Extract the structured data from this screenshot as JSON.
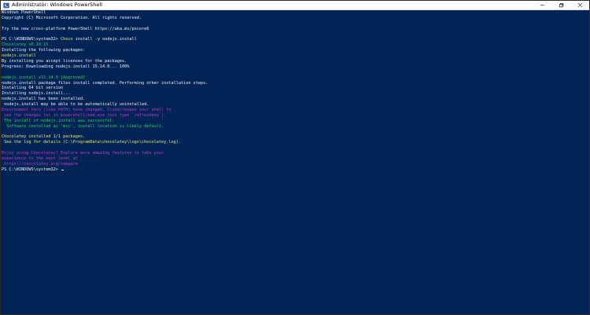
{
  "window": {
    "title": "Administrator: Windows PowerShell",
    "icon": "powershell-icon",
    "controls": [
      "minimize-icon",
      "maximize-icon",
      "close-icon"
    ]
  },
  "colors": {
    "console_bg": "#012456",
    "text": "#f0f0f0",
    "yellow": "#e9e66a",
    "green": "#2fd35a",
    "magenta": "#d033d8"
  },
  "console": {
    "lines": [
      {
        "segments": [
          {
            "text": "Windows PowerShell",
            "color": "white"
          }
        ]
      },
      {
        "segments": [
          {
            "text": "Copyright (C) Microsoft Corporation. All rights reserved.",
            "color": "white"
          }
        ]
      },
      {
        "segments": [
          {
            "text": "",
            "color": "white"
          }
        ]
      },
      {
        "segments": [
          {
            "text": "Try the new cross-platform PowerShell https://aka.ms/pscore6",
            "color": "white"
          }
        ]
      },
      {
        "segments": [
          {
            "text": "",
            "color": "white"
          }
        ]
      },
      {
        "segments": [
          {
            "text": "PS C:\\WINDOWS\\system32> ",
            "color": "white"
          },
          {
            "text": "Choco",
            "color": "yellow"
          },
          {
            "text": " install -y nodejs.install",
            "color": "white"
          }
        ]
      },
      {
        "segments": [
          {
            "text": "Chocolatey v0.10.15",
            "color": "green"
          }
        ]
      },
      {
        "segments": [
          {
            "text": "Installing the following packages:",
            "color": "white"
          }
        ]
      },
      {
        "segments": [
          {
            "text": "nodejs.install",
            "color": "yellow"
          }
        ]
      },
      {
        "segments": [
          {
            "text": "By installing you accept licenses for the packages.",
            "color": "white"
          }
        ]
      },
      {
        "segments": [
          {
            "text": "Progress: Downloading nodejs.install 15.14.0... 100%",
            "color": "white"
          }
        ]
      },
      {
        "segments": [
          {
            "text": "",
            "color": "white"
          }
        ]
      },
      {
        "segments": [
          {
            "text": "nodejs.install v15.14.0 [Approved]",
            "color": "green"
          }
        ]
      },
      {
        "segments": [
          {
            "text": "nodejs.install package files install completed. Performing other installation steps.",
            "color": "white"
          }
        ]
      },
      {
        "segments": [
          {
            "text": "Installing 64 bit version",
            "color": "white"
          }
        ]
      },
      {
        "segments": [
          {
            "text": "Installing nodejs.install...",
            "color": "white"
          }
        ]
      },
      {
        "segments": [
          {
            "text": "nodejs.install has been installed.",
            "color": "white"
          }
        ]
      },
      {
        "segments": [
          {
            "text": " nodejs.install may be able to be automatically uninstalled.",
            "color": "white"
          }
        ]
      },
      {
        "segments": [
          {
            "text": "Environment Vars (like PATH) have changed. Close/reopen your shell to",
            "color": "magenta"
          }
        ]
      },
      {
        "segments": [
          {
            "text": " see the changes (or in powershell/cmd.exe just type `refreshenv`).",
            "color": "magenta"
          }
        ]
      },
      {
        "segments": [
          {
            "text": " The install of nodejs.install was successful.",
            "color": "green"
          }
        ]
      },
      {
        "segments": [
          {
            "text": "  Software installed as 'msi', install location is likely default.",
            "color": "green"
          }
        ]
      },
      {
        "segments": [
          {
            "text": "",
            "color": "white"
          }
        ]
      },
      {
        "segments": [
          {
            "text": "Chocolatey installed 1/1 packages.",
            "color": "yellow"
          }
        ]
      },
      {
        "segments": [
          {
            "text": " See the log for details (C:\\ProgramData\\chocolatey\\logs\\chocolatey.log).",
            "color": "yellow"
          }
        ]
      },
      {
        "segments": [
          {
            "text": "",
            "color": "white"
          }
        ]
      },
      {
        "segments": [
          {
            "text": "Enjoy using Chocolatey? Explore more amazing features to take your",
            "color": "magenta"
          }
        ]
      },
      {
        "segments": [
          {
            "text": "experience to the next level at",
            "color": "magenta"
          }
        ]
      },
      {
        "segments": [
          {
            "text": " https://chocolatey.org/compare",
            "color": "magenta"
          }
        ]
      },
      {
        "segments": [
          {
            "text": "PS C:\\WINDOWS\\system32> ",
            "color": "white"
          }
        ],
        "cursor": true
      }
    ]
  }
}
